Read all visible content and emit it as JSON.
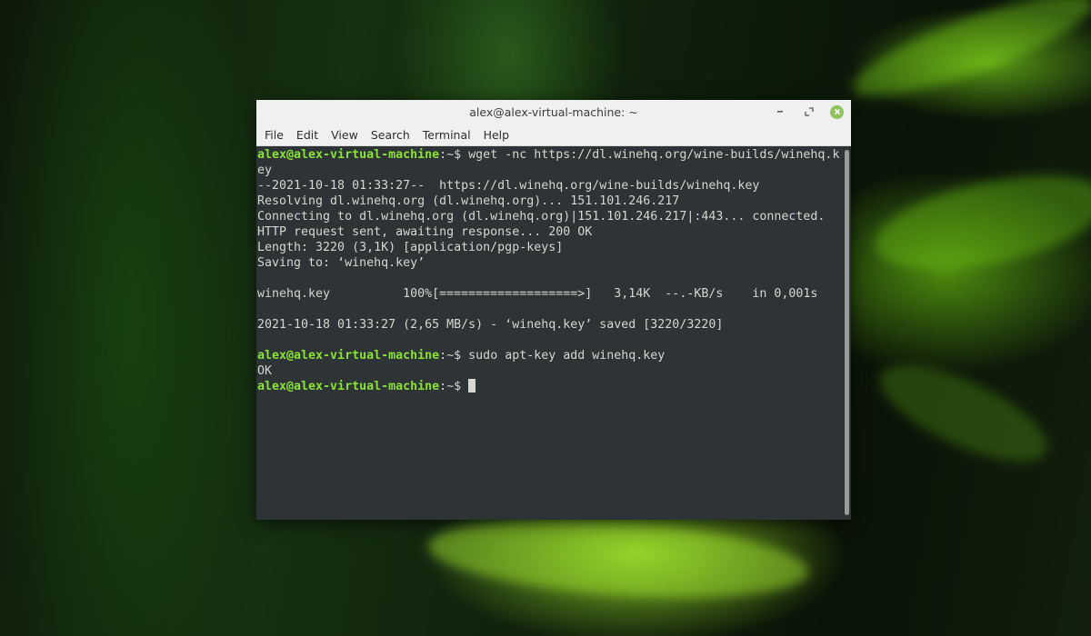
{
  "window": {
    "title": "alex@alex-virtual-machine: ~",
    "controls": {
      "minimize_icon": "minimize-icon",
      "maximize_icon": "maximize-icon",
      "close_icon": "close-icon",
      "close_color": "#8fc25a"
    }
  },
  "menu": {
    "items": [
      "File",
      "Edit",
      "View",
      "Search",
      "Terminal",
      "Help"
    ]
  },
  "terminal": {
    "colors": {
      "background": "#2e3436",
      "foreground": "#d3d7cf",
      "prompt_user": "#8ae234"
    },
    "prompt_user": "alex@alex-virtual-machine",
    "prompt_path": ":~$ ",
    "lines": [
      {
        "type": "prompt",
        "cmd": "wget -nc https://dl.winehq.org/wine-builds/winehq.k"
      },
      {
        "type": "output",
        "text": "ey"
      },
      {
        "type": "output",
        "text": "--2021-10-18 01:33:27--  https://dl.winehq.org/wine-builds/winehq.key"
      },
      {
        "type": "output",
        "text": "Resolving dl.winehq.org (dl.winehq.org)... 151.101.246.217"
      },
      {
        "type": "output",
        "text": "Connecting to dl.winehq.org (dl.winehq.org)|151.101.246.217|:443... connected."
      },
      {
        "type": "output",
        "text": "HTTP request sent, awaiting response... 200 OK"
      },
      {
        "type": "output",
        "text": "Length: 3220 (3,1K) [application/pgp-keys]"
      },
      {
        "type": "output",
        "text": "Saving to: ‘winehq.key’"
      },
      {
        "type": "output",
        "text": ""
      },
      {
        "type": "output",
        "text": "winehq.key          100%[===================>]   3,14K  --.-KB/s    in 0,001s"
      },
      {
        "type": "output",
        "text": ""
      },
      {
        "type": "output",
        "text": "2021-10-18 01:33:27 (2,65 MB/s) - ‘winehq.key’ saved [3220/3220]"
      },
      {
        "type": "output",
        "text": ""
      },
      {
        "type": "prompt",
        "cmd": "sudo apt-key add winehq.key"
      },
      {
        "type": "output",
        "text": "OK"
      },
      {
        "type": "prompt",
        "cmd": "",
        "cursor": true
      }
    ]
  }
}
